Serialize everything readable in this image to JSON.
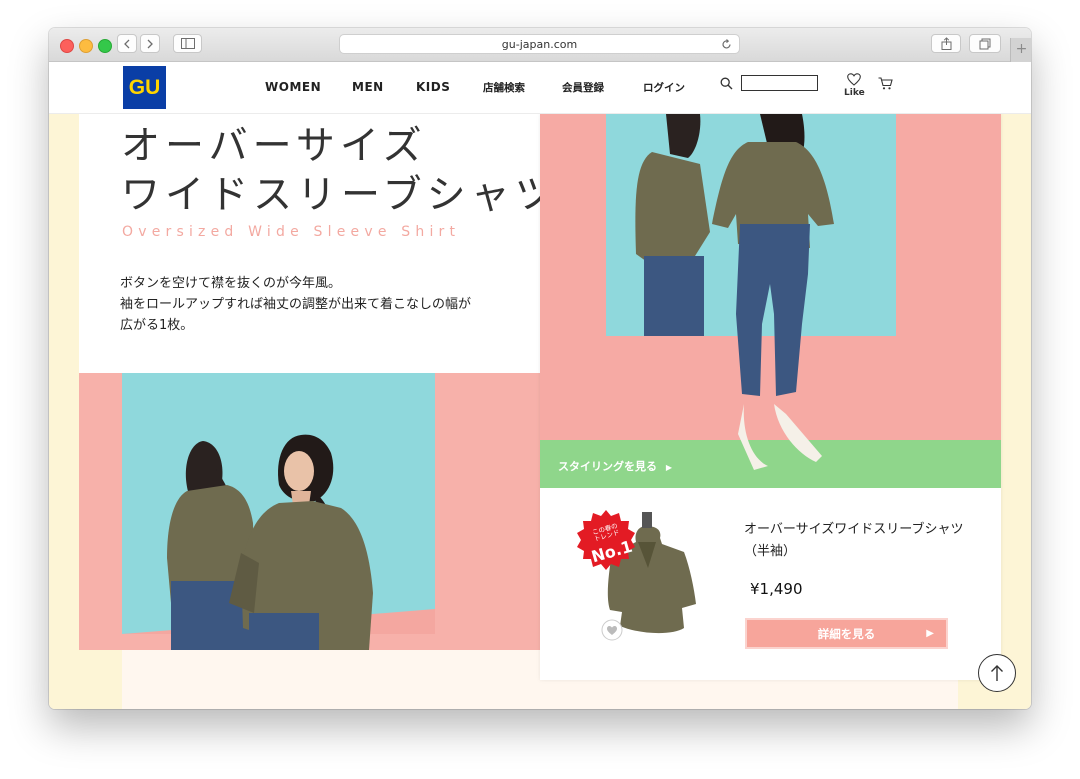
{
  "browser": {
    "url": "gu-japan.com",
    "back_icon": "chevron-left-icon",
    "forward_icon": "chevron-right-icon",
    "sidebar_icon": "sidebar-icon",
    "reload_icon": "reload-icon",
    "share_icon": "share-icon",
    "tabs_icon": "tabs-icon",
    "new_tab_label": "+"
  },
  "header": {
    "logo": "GU",
    "nav": [
      {
        "label": "WOMEN"
      },
      {
        "label": "MEN"
      },
      {
        "label": "KIDS"
      },
      {
        "label": "店舗検索"
      },
      {
        "label": "会員登録"
      },
      {
        "label": "ログイン"
      }
    ],
    "search_value": "",
    "like_label": "Like"
  },
  "hero": {
    "title_line1": "オーバーサイズ",
    "title_line2": "ワイドスリーブシャツ",
    "subtitle": "Oversized Wide Sleeve Shirt",
    "desc_line1": "ボタンを空けて襟を抜くのが今年風。",
    "desc_line2": "袖をロールアップすれば袖丈の調整が出来て着こなしの幅が",
    "desc_line3": "広がる1枚。"
  },
  "styling": {
    "label": "スタイリングを見る",
    "arrow": "▶"
  },
  "product": {
    "badge_small": "この春の トレンド",
    "badge_big": "No.1",
    "name": "オーバーサイズワイドスリーブシャツ（半袖）",
    "price": "¥1,490",
    "detail_label": "詳細を見る",
    "detail_arrow": "▶"
  },
  "colors": {
    "brand_blue": "#0a3ea6",
    "brand_yellow": "#ffd400",
    "pink": "#f6aaa4",
    "teal": "#8fd8dc",
    "green": "#8fd68b",
    "shirt": "#6f6b4f",
    "denim": "#3c5781",
    "bg_cream": "#fdf5d6"
  }
}
